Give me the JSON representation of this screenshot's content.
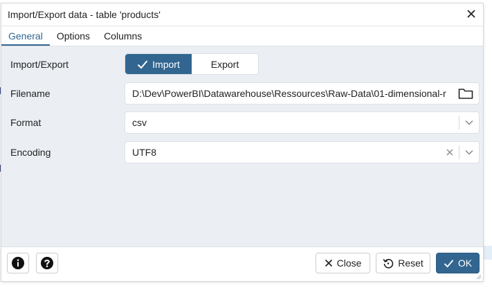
{
  "dialog": {
    "title": "Import/Export data - table 'products'",
    "close_icon": "close-icon"
  },
  "tabs": [
    {
      "label": "General",
      "active": true
    },
    {
      "label": "Options",
      "active": false
    },
    {
      "label": "Columns",
      "active": false
    }
  ],
  "form": {
    "import_export": {
      "label": "Import/Export",
      "import_label": "Import",
      "export_label": "Export",
      "selected": "Import"
    },
    "filename": {
      "label": "Filename",
      "value": "D:\\Dev\\PowerBI\\Datawarehouse\\Ressources\\Raw-Data\\01-dimensional-r"
    },
    "format": {
      "label": "Format",
      "value": "csv"
    },
    "encoding": {
      "label": "Encoding",
      "value": "UTF8"
    }
  },
  "footer": {
    "info_icon": "info-icon",
    "help_icon": "help-icon",
    "close_label": "Close",
    "reset_label": "Reset",
    "ok_label": "OK"
  },
  "colors": {
    "primary": "#326690",
    "body_bg": "#ebeef3",
    "border": "#dde0e6"
  }
}
